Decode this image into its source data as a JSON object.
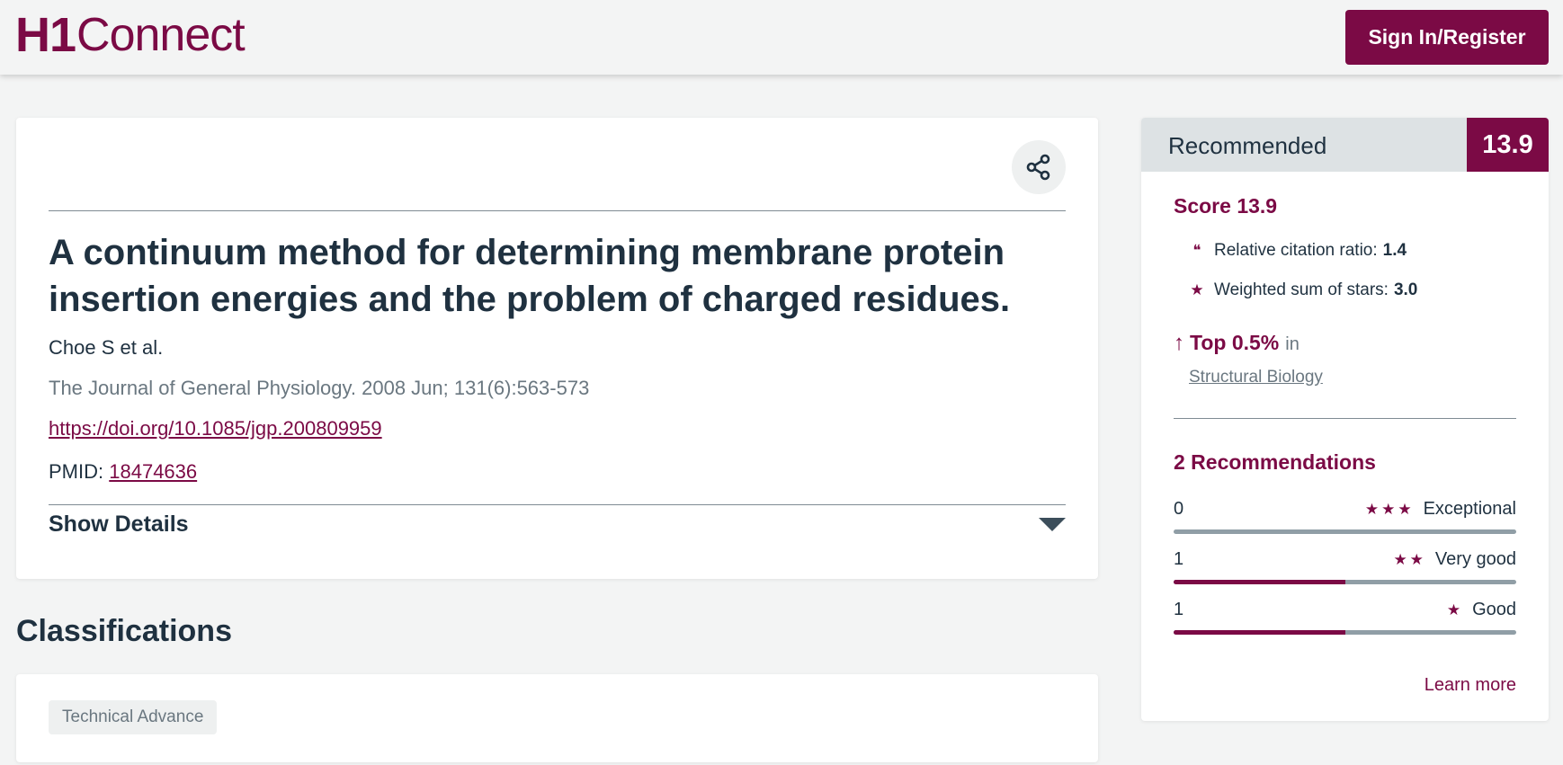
{
  "header": {
    "logo_mark": "H1",
    "logo_text": "Connect",
    "signin_label": "Sign In/Register"
  },
  "article": {
    "title": "A continuum method for determining membrane protein insertion energies and the problem of charged residues.",
    "authors": "Choe S et al.",
    "journal": "The Journal of General Physiology. 2008 Jun; 131(6):563-573",
    "doi": "https://doi.org/10.1085/jgp.200809959",
    "pmid_label": "PMID:",
    "pmid": "18474636",
    "show_details": "Show Details"
  },
  "classifications": {
    "heading": "Classifications",
    "tags": [
      "Technical Advance"
    ]
  },
  "recommended": {
    "heading": "Recommended",
    "score_box": "13.9",
    "score_line": "Score 13.9",
    "rcr_label": "Relative citation ratio:",
    "rcr_value": "1.4",
    "stars_label": "Weighted sum of stars:",
    "stars_value": "3.0",
    "top_value": "Top 0.5%",
    "top_in": "in",
    "field": "Structural Biology",
    "count_label": "2 Recommendations",
    "ratings": [
      {
        "count": "0",
        "stars": "★★★",
        "label": "Exceptional",
        "fraction": 0.0
      },
      {
        "count": "1",
        "stars": "★★",
        "label": "Very good",
        "fraction": 0.5
      },
      {
        "count": "1",
        "stars": "★",
        "label": "Good",
        "fraction": 0.5
      }
    ],
    "learn_more": "Learn more"
  },
  "colors": {
    "brand": "#7b0a45",
    "text": "#1f3140",
    "muted": "#6a7780",
    "bar_track": "#909ea6"
  },
  "icons": [
    "share-icon",
    "quote-icon",
    "star-icon",
    "arrow-up-icon",
    "caret-down-icon"
  ]
}
